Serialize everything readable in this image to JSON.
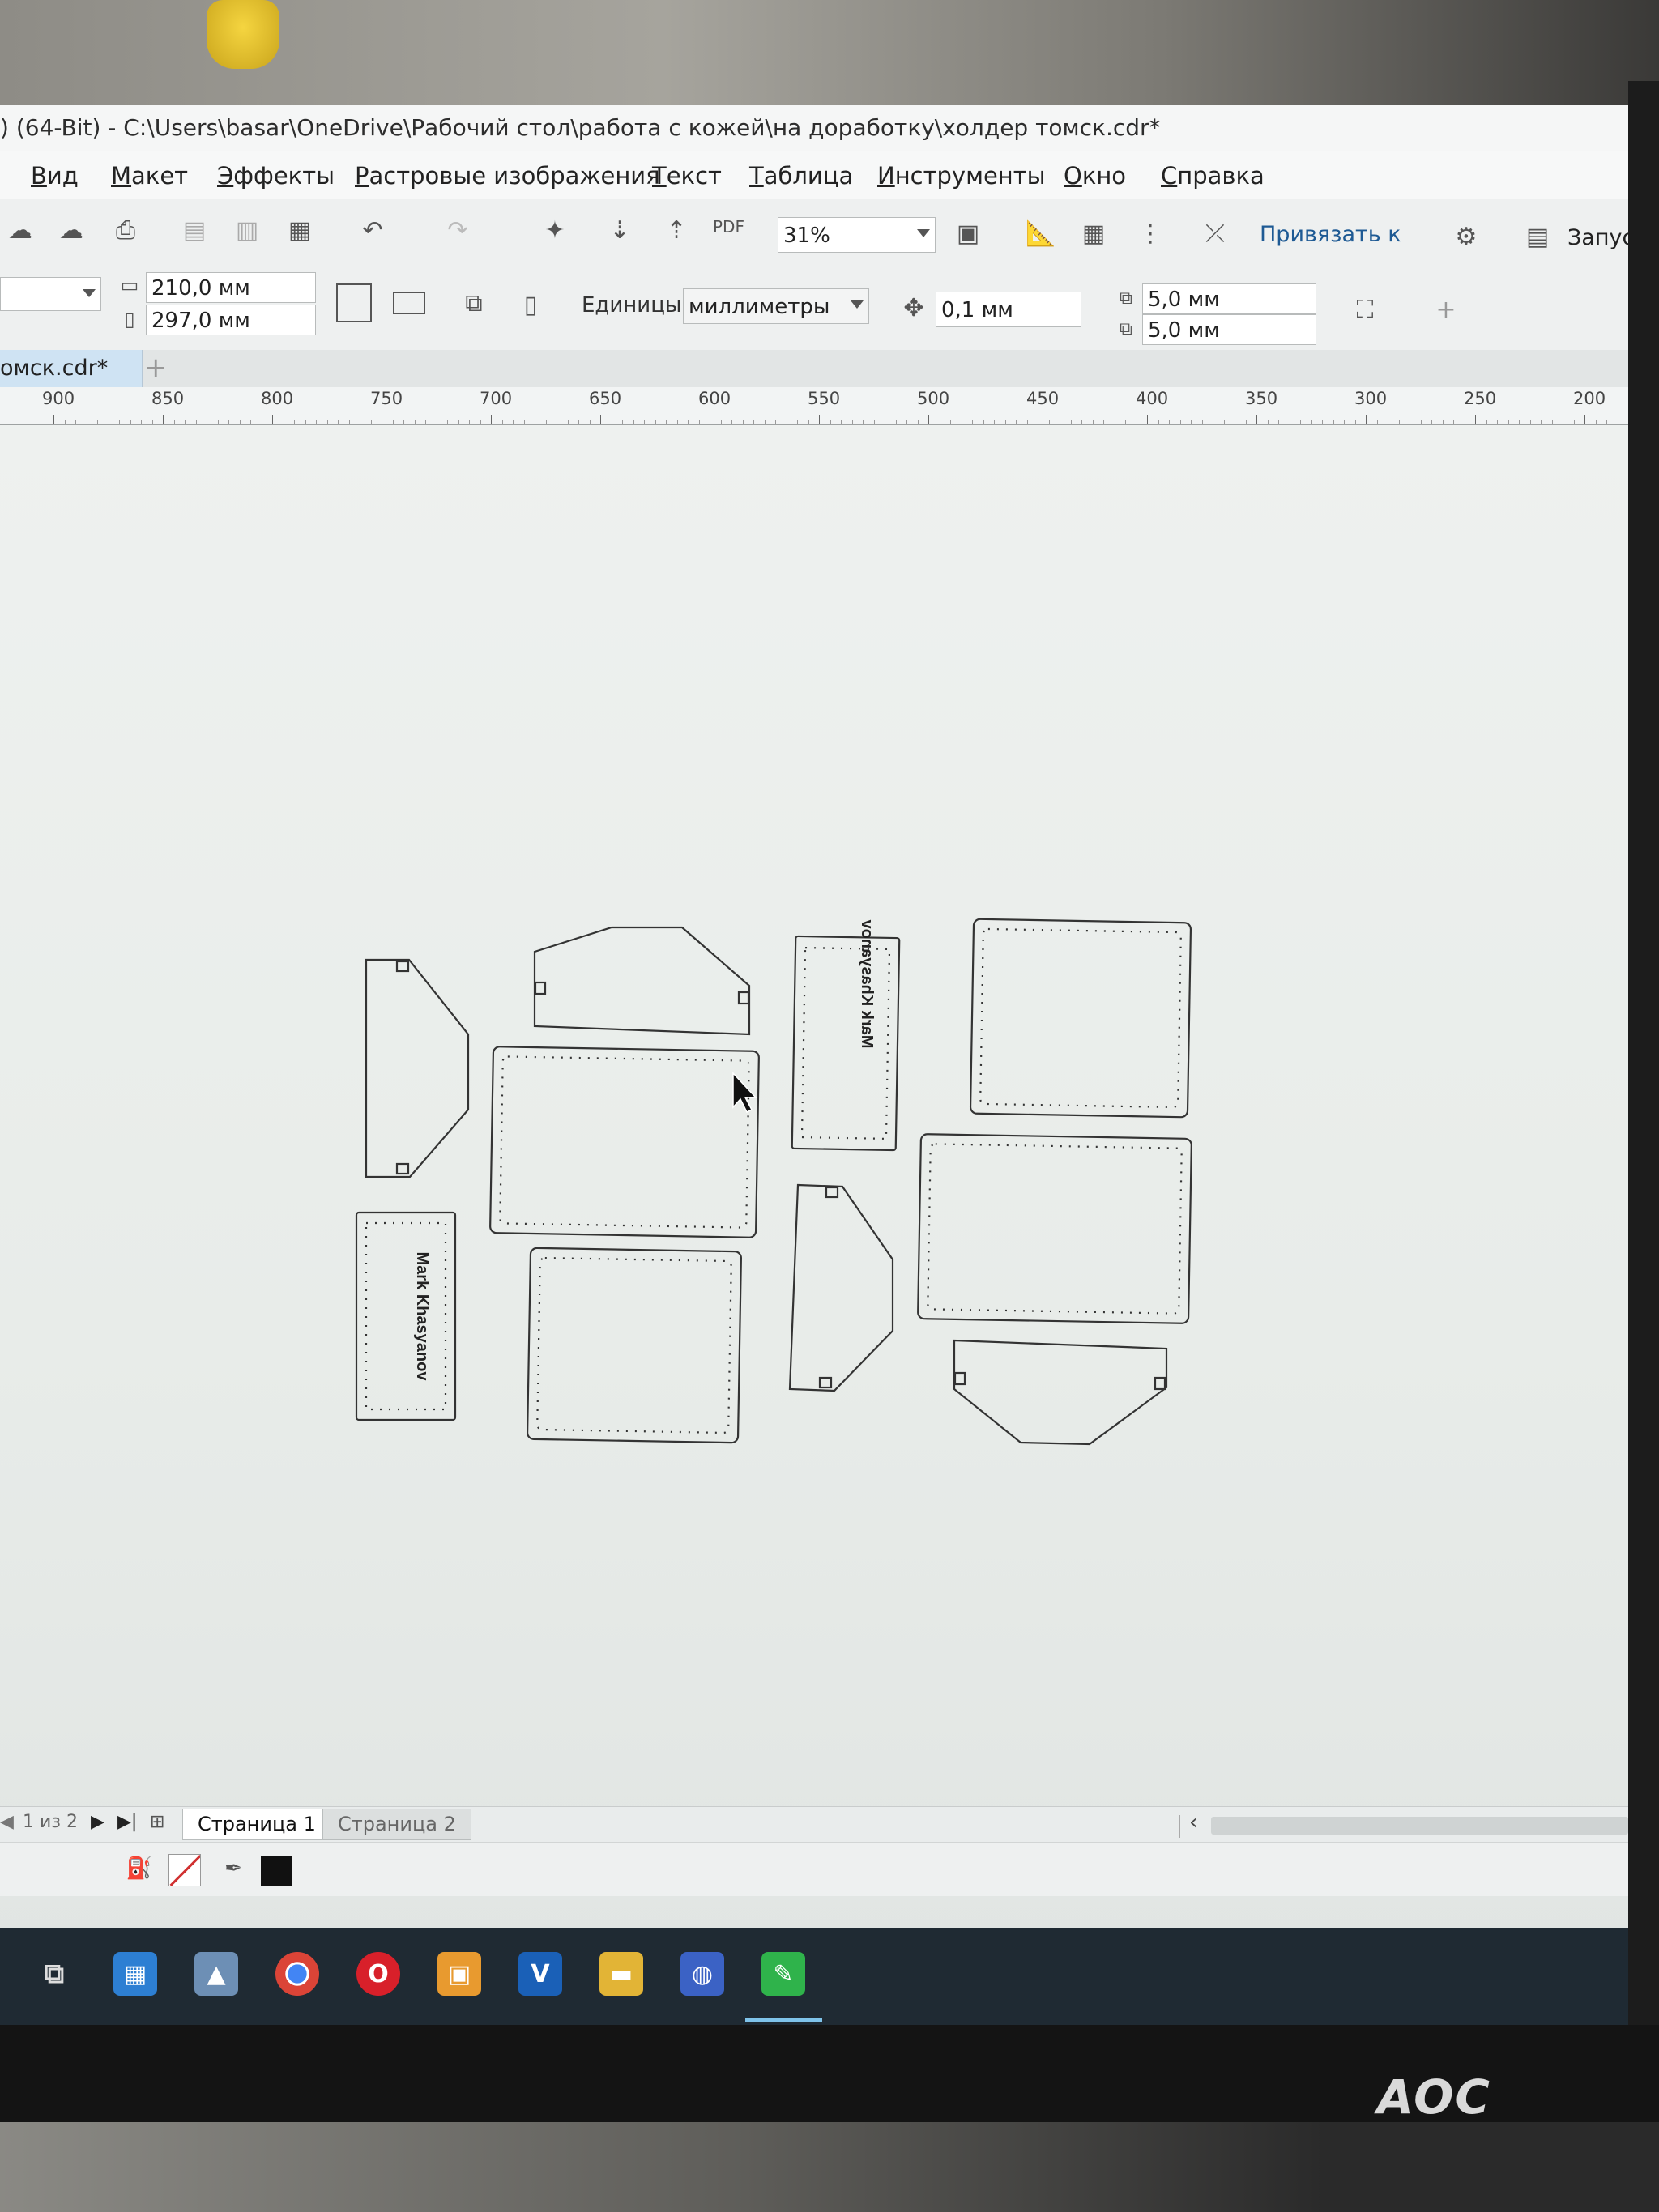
{
  "window": {
    "title": ") (64-Bit) - C:\\Users\\basar\\OneDrive\\Рабочий стол\\работа с кожей\\на доработку\\холдер томск.cdr*"
  },
  "menu": {
    "items": [
      "Вид",
      "Макет",
      "Эффекты",
      "Растровые изображения",
      "Текст",
      "Таблица",
      "Инструменты",
      "Окно",
      "Справка"
    ]
  },
  "toolbar": {
    "pdf_label": "PDF",
    "zoom_value": "31%",
    "snap_label": "Привязать к",
    "launch_label": "Запуск"
  },
  "property_bar": {
    "width_value": "210,0 мм",
    "height_value": "297,0 мм",
    "units_label": "Единицы:",
    "units_value": "миллиметры",
    "nudge_value": "0,1 мм",
    "dup_x_value": "5,0 мм",
    "dup_y_value": "5,0 мм"
  },
  "document_tab": {
    "name": "омск.cdr*",
    "add_symbol": "+"
  },
  "ruler": {
    "labels": [
      "900",
      "850",
      "800",
      "750",
      "700",
      "650",
      "600",
      "550",
      "500",
      "450",
      "400",
      "350",
      "300",
      "250",
      "200"
    ]
  },
  "drawing": {
    "text_rotated_a": "Mark Khasyanov",
    "text_rotated_b": "Mark Khasyanov"
  },
  "pages": {
    "counter": "1 из 2",
    "page1": "Страница 1",
    "page2": "Страница 2"
  },
  "monitor": {
    "brand": "AOC"
  },
  "colors": {
    "accent": "#1f6fb6",
    "outline": "#333333",
    "fill_swatch": "#111111",
    "no_fill": "#d03030"
  }
}
